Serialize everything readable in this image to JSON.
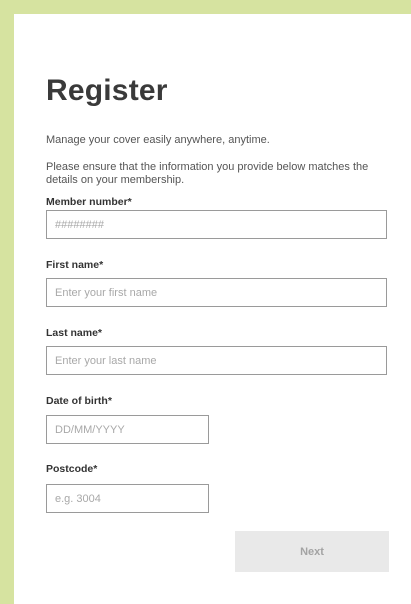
{
  "form": {
    "title": "Register",
    "intro": "Manage your cover easily anywhere, anytime.",
    "note": "Please ensure that the information you provide below matches the details on your membership.",
    "fields": {
      "member_number": {
        "label": "Member number*",
        "value": "",
        "placeholder": "########"
      },
      "first_name": {
        "label": "First name*",
        "value": "",
        "placeholder": "Enter your first name"
      },
      "last_name": {
        "label": "Last name*",
        "value": "",
        "placeholder": "Enter your last name"
      },
      "dob": {
        "label": "Date of birth*",
        "value": "",
        "placeholder": "DD/MM/YYYY"
      },
      "postcode": {
        "label": "Postcode*",
        "value": "",
        "placeholder": "e.g. 3004"
      }
    },
    "next_label": "Next"
  }
}
